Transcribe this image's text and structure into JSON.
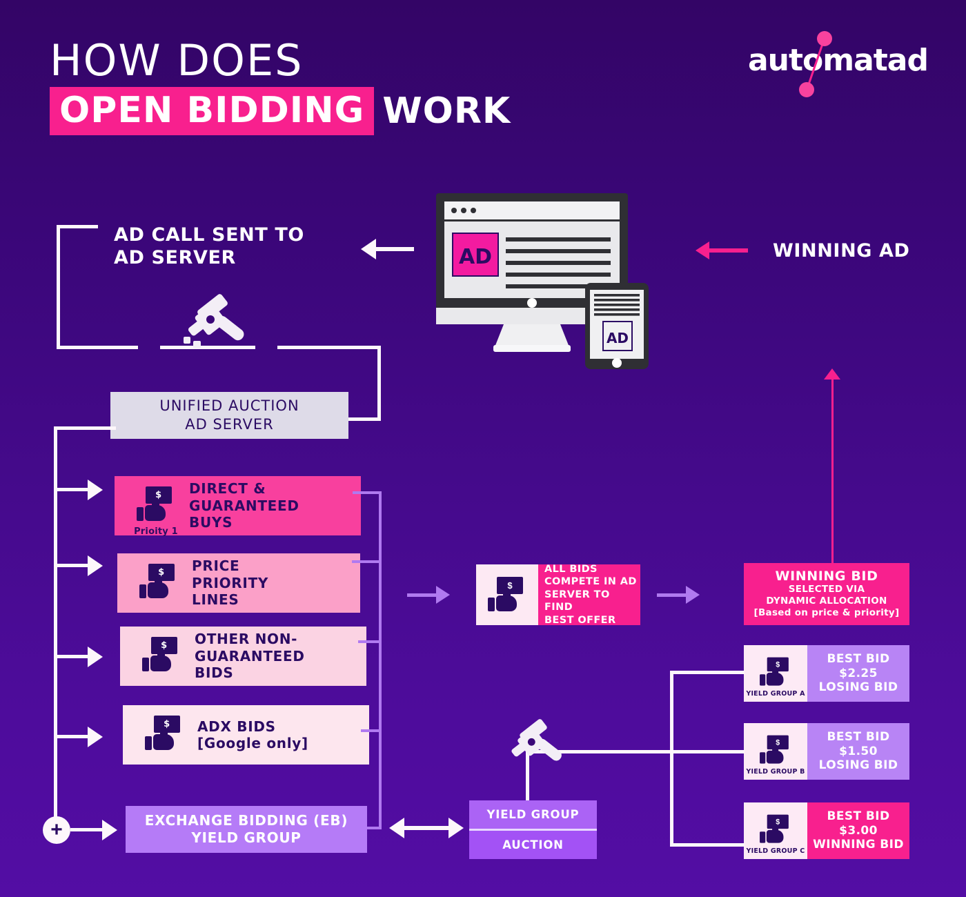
{
  "header": {
    "line1": "HOW DOES",
    "highlight": "OPEN BIDDING",
    "rest": "WORK",
    "logo": "automatad"
  },
  "flow": {
    "ad_call_label": "AD CALL SENT TO\nAD SERVER",
    "ad_call_line1": "AD CALL SENT TO",
    "ad_call_line2": "AD SERVER",
    "winning_ad_label": "WINNING AD",
    "unified_line1": "UNIFIED AUCTION",
    "unified_line2": "AD SERVER",
    "plus_symbol": "+"
  },
  "device": {
    "ad_badge_desktop": "AD",
    "ad_badge_tablet": "AD"
  },
  "priority_boxes": [
    {
      "lines": [
        "DIRECT &",
        "GUARANTEED",
        "BUYS"
      ],
      "sub": "Prioity 1",
      "bg": "#f8409e",
      "icon": "money-hand-icon"
    },
    {
      "lines": [
        "PRICE",
        "PRIORITY",
        "LINES"
      ],
      "sub": "",
      "bg": "#fba0c8",
      "icon": "money-hand-icon"
    },
    {
      "lines": [
        "OTHER NON-",
        "GUARANTEED",
        "BIDS"
      ],
      "sub": "",
      "bg": "#fbd3e3",
      "icon": "money-hand-icon"
    },
    {
      "lines": [
        "ADX BIDS",
        "[Google only]"
      ],
      "sub": "",
      "bg": "#fde6ee",
      "icon": "money-hand-icon"
    }
  ],
  "exchange_bidding": {
    "line1": "EXCHANGE BIDDING (EB)",
    "line2": "YIELD GROUP"
  },
  "compete": {
    "lines": [
      "ALL BIDS",
      "COMPETE IN AD",
      "SERVER TO FIND",
      "BEST OFFER"
    ],
    "icon": "money-hand-icon"
  },
  "winning_bid": {
    "title": "WINNING BID",
    "line2": "SELECTED VIA",
    "line3": "DYNAMIC ALLOCATION",
    "line4": "[Based on price & priority]"
  },
  "yield_groups": [
    {
      "label": "YIELD GROUP A",
      "bid_label": "BEST BID",
      "amount": "$2.25",
      "status": "LOSING BID",
      "bg": "#b884f5"
    },
    {
      "label": "YIELD GROUP B",
      "bid_label": "BEST BID",
      "amount": "$1.50",
      "status": "LOSING BID",
      "bg": "#b884f5"
    },
    {
      "label": "YIELD GROUP C",
      "bid_label": "BEST BID",
      "amount": "$3.00",
      "status": "WINNING BID",
      "bg": "#f8208e"
    }
  ],
  "yield_group_auction": {
    "title": "YIELD GROUP",
    "subtitle": "AUCTION"
  },
  "icons": {
    "gavel_top": "gavel-icon",
    "gavel_bottom": "gavel-icon"
  },
  "colors": {
    "bg_top": "#330566",
    "bg_bottom": "#530da4",
    "pink": "#f8208e",
    "purple_light": "#b07af0",
    "white": "#fdf7fb",
    "deep_purple_text": "#2b0b63"
  }
}
